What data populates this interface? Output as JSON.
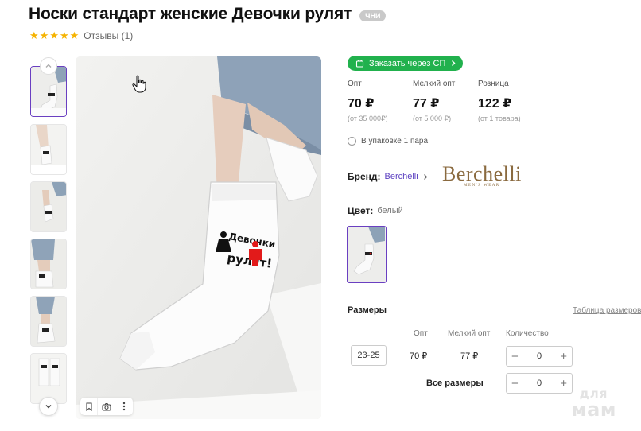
{
  "product": {
    "title": "Носки стандарт женские Девочки рулят",
    "badge": "ЧНИ",
    "stars": [
      "★",
      "★",
      "★",
      "★",
      "★"
    ],
    "reviews": "Отзывы (1)"
  },
  "order_button": {
    "label": "Заказать через СП",
    "icon": "bag-icon",
    "color": "#21b14d"
  },
  "prices": [
    {
      "label": "Опт",
      "value": "70 ₽",
      "note": "(от 35 000₽)"
    },
    {
      "label": "Мелкий опт",
      "value": "77 ₽",
      "note": "(от 5 000 ₽)"
    },
    {
      "label": "Розница",
      "value": "122 ₽",
      "note": "(от 1 товара)"
    }
  ],
  "pack_note": "В упаковке 1 пара",
  "brand": {
    "label": "Бренд:",
    "name": "Berchelli",
    "logo_main": "Berchelli",
    "logo_sub": "MEN'S WEAR"
  },
  "color": {
    "label": "Цвет:",
    "value": "белый"
  },
  "sizes": {
    "label": "Размеры",
    "table_link": "Таблица размеров",
    "headers": {
      "opt": "Опт",
      "small_opt": "Мелкий опт",
      "qty": "Количество"
    },
    "rows": [
      {
        "size": "23-25",
        "opt": "70 ₽",
        "small_opt": "77 ₽",
        "qty": "0"
      }
    ],
    "all_sizes_label": "Все размеры",
    "all_qty": "0"
  },
  "sock_print": {
    "line1": "Девочки",
    "line2": "рулят!"
  },
  "watermark": {
    "line1": "для",
    "line2": "мам"
  },
  "accent_color": "#6a3fc1"
}
